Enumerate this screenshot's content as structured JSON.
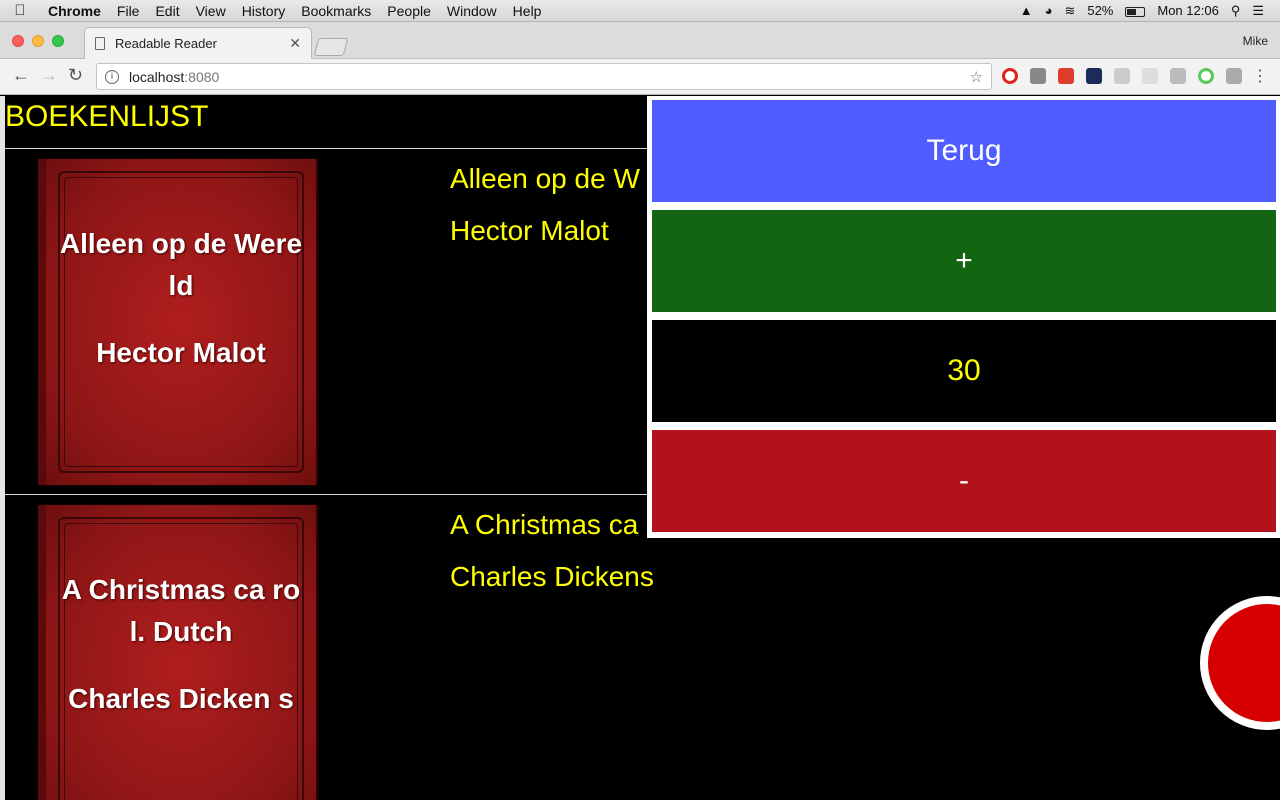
{
  "menubar": {
    "app": "Chrome",
    "items": [
      "File",
      "Edit",
      "View",
      "History",
      "Bookmarks",
      "People",
      "Window",
      "Help"
    ],
    "battery": "52%",
    "clock": "Mon 12:06"
  },
  "browser": {
    "tab_title": "Readable Reader",
    "profile": "Mike",
    "url_host": "localhost",
    "url_port": ":8080"
  },
  "page": {
    "title": "BOEKENLIJST",
    "books": [
      {
        "cover_title": "Alleen op de Wereld",
        "cover_author": "Hector Malot",
        "title": "Alleen op de W",
        "author": "Hector Malot"
      },
      {
        "cover_title": "A Christmas ca rol. Dutch",
        "cover_author": "Charles Dicken s",
        "title": "A Christmas ca",
        "author": "Charles Dickens"
      }
    ]
  },
  "panel": {
    "back_label": "Terug",
    "plus_label": "+",
    "value": "30",
    "minus_label": "-"
  },
  "colors": {
    "accent_text": "#ffff00",
    "back": "#4f5cff",
    "plus": "#136512",
    "minus": "#b1121c",
    "record": "#d60000"
  }
}
